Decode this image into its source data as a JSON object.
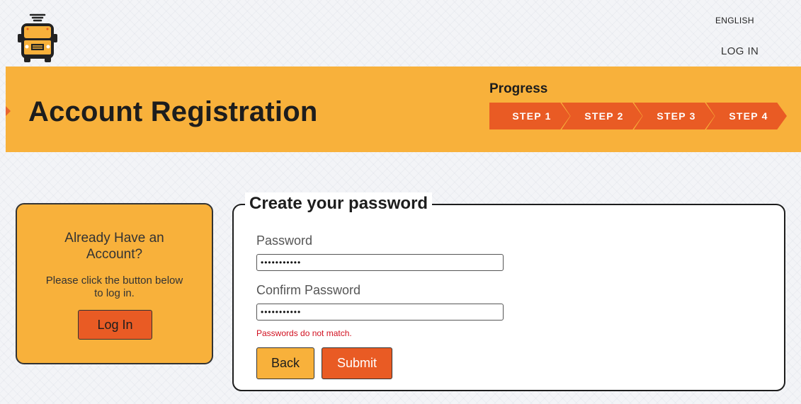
{
  "header": {
    "logo_icon": "school-bus-icon",
    "language_link": "ENGLISH",
    "login_link": "LOG IN"
  },
  "banner": {
    "title": "Account Registration",
    "progress_label": "Progress",
    "steps": [
      "STEP 1",
      "STEP 2",
      "STEP 3",
      "STEP 4"
    ],
    "color": "#f8b13b",
    "step_color": "#e95b24"
  },
  "account_card": {
    "heading": "Already Have an Account?",
    "text": "Please click the button below to log in.",
    "button_label": "Log In"
  },
  "password_form": {
    "legend": "Create your password",
    "password_label": "Password",
    "password_value": "•••••••••••",
    "confirm_label": "Confirm Password",
    "confirm_value": "•••••••••••",
    "error_message": "Passwords do not match.",
    "error_color": "#d10f1f",
    "back_label": "Back",
    "submit_label": "Submit"
  }
}
